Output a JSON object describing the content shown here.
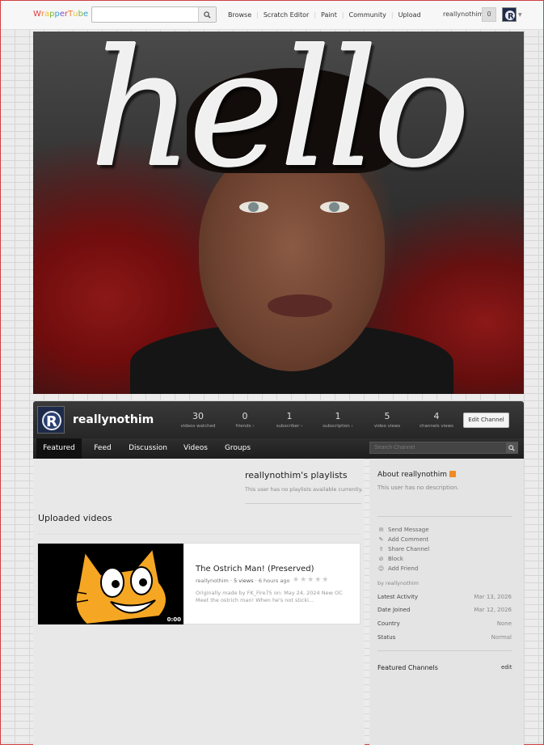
{
  "header": {
    "logo_letters": [
      "W",
      "r",
      "a",
      "p",
      "p",
      "e",
      "r",
      "T",
      "u",
      "b",
      "e"
    ],
    "logo_colors": [
      "#e23b3b",
      "#f08030",
      "#f0c030",
      "#7ab830",
      "#30a0d0",
      "#8050c0",
      "#e23b3b",
      "#f08030",
      "#f0c030",
      "#7ab830",
      "#30a0d0"
    ],
    "search_placeholder": "",
    "nav": [
      "Browse",
      "Scratch Editor",
      "Paint",
      "Community",
      "Upload"
    ],
    "username": "reallynothim",
    "notif_count": "0"
  },
  "banner": {
    "text": "hello"
  },
  "channel": {
    "name": "reallynothim",
    "stats": [
      {
        "num": "30",
        "label": "videos watched"
      },
      {
        "num": "0",
        "label": "friends ›"
      },
      {
        "num": "1",
        "label": "subscriber ›"
      },
      {
        "num": "1",
        "label": "subscription ›"
      },
      {
        "num": "5",
        "label": "video views"
      },
      {
        "num": "4",
        "label": "channels views"
      }
    ],
    "edit_label": "Edit Channel"
  },
  "tabs": [
    "Featured",
    "Feed",
    "Discussion",
    "Videos",
    "Groups"
  ],
  "tab_search_placeholder": "Search Channel",
  "playlists": {
    "title": "reallynothim's playlists",
    "note": "This user has no playlists available currently."
  },
  "uploaded": {
    "title": "Uploaded videos",
    "video": {
      "title": "The Ostrich Man! (Preserved)",
      "author": "reallynothim",
      "views": "5 views",
      "age": "6 hours ago",
      "duration": "0:00",
      "desc": "Originally made by FK_Fire75 on: May 24, 2024 New OC Meet the ostrich man! When he's not sticki..."
    }
  },
  "sidebar": {
    "about_title": "About reallynothim",
    "no_desc": "This user has no description.",
    "actions": [
      "Send Message",
      "Add Comment",
      "Share Channel",
      "Block",
      "Add Friend"
    ],
    "by": "by reallynothim",
    "info": [
      {
        "label": "Latest Activity",
        "value": "Mar 13, 2026"
      },
      {
        "label": "Date Joined",
        "value": "Mar 12, 2026"
      },
      {
        "label": "Country",
        "value": "None"
      },
      {
        "label": "Status",
        "value": "Normal"
      }
    ],
    "featured_title": "Featured Channels",
    "featured_edit": "edit"
  }
}
